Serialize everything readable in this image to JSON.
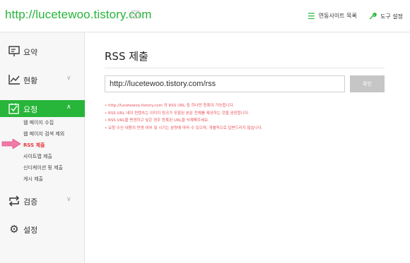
{
  "header": {
    "site_url": "http://lucetewoo.tistory.com",
    "dropdown_glyph": "∨",
    "linked_sites_label": "연동사이트 목록",
    "tool_settings_label": "도구 설정",
    "accent_color": "#27b53a"
  },
  "sidebar": {
    "items": [
      {
        "label": "요약",
        "icon": "presentation-board-icon"
      },
      {
        "label": "현황",
        "icon": "line-chart-icon"
      },
      {
        "label": "요청",
        "icon": "checkbox-icon",
        "active": true
      },
      {
        "label": "검증",
        "icon": "sync-arrows-icon"
      },
      {
        "label": "설정",
        "icon": "gear-icon"
      }
    ],
    "request_sub_items": [
      "웹 페이지 수집",
      "웹 페이지 검색 제외",
      "RSS 제출",
      "사이트맵 제출",
      "신디케이션 핑 제출",
      "게시 제출"
    ],
    "current_sub_item": "RSS 제출",
    "highlight_color": "#e8343a"
  },
  "main": {
    "title": "RSS 제출",
    "rss_input_value": "http://lucetewoo.tistory.com/rss",
    "confirm_button": "확인",
    "notes": [
      "• http://lucetewoo.tistory.com 의 RSS URL 중 하나만 등록이 가능합니다.",
      "• RSS URL 내의 컨텐츠는 이미지 링크가 포함된 본문 전체를 제공하는 것을 권장합니다.",
      "• RSS URL을 변경하고 싶은 경우 등록된 URL을 삭제해주세요.",
      "• 요청 수신 내용의 반영 여부 및 시기는 분량에 따라 수 있으며, 개별적으로 답변드리지 않습니다."
    ]
  }
}
